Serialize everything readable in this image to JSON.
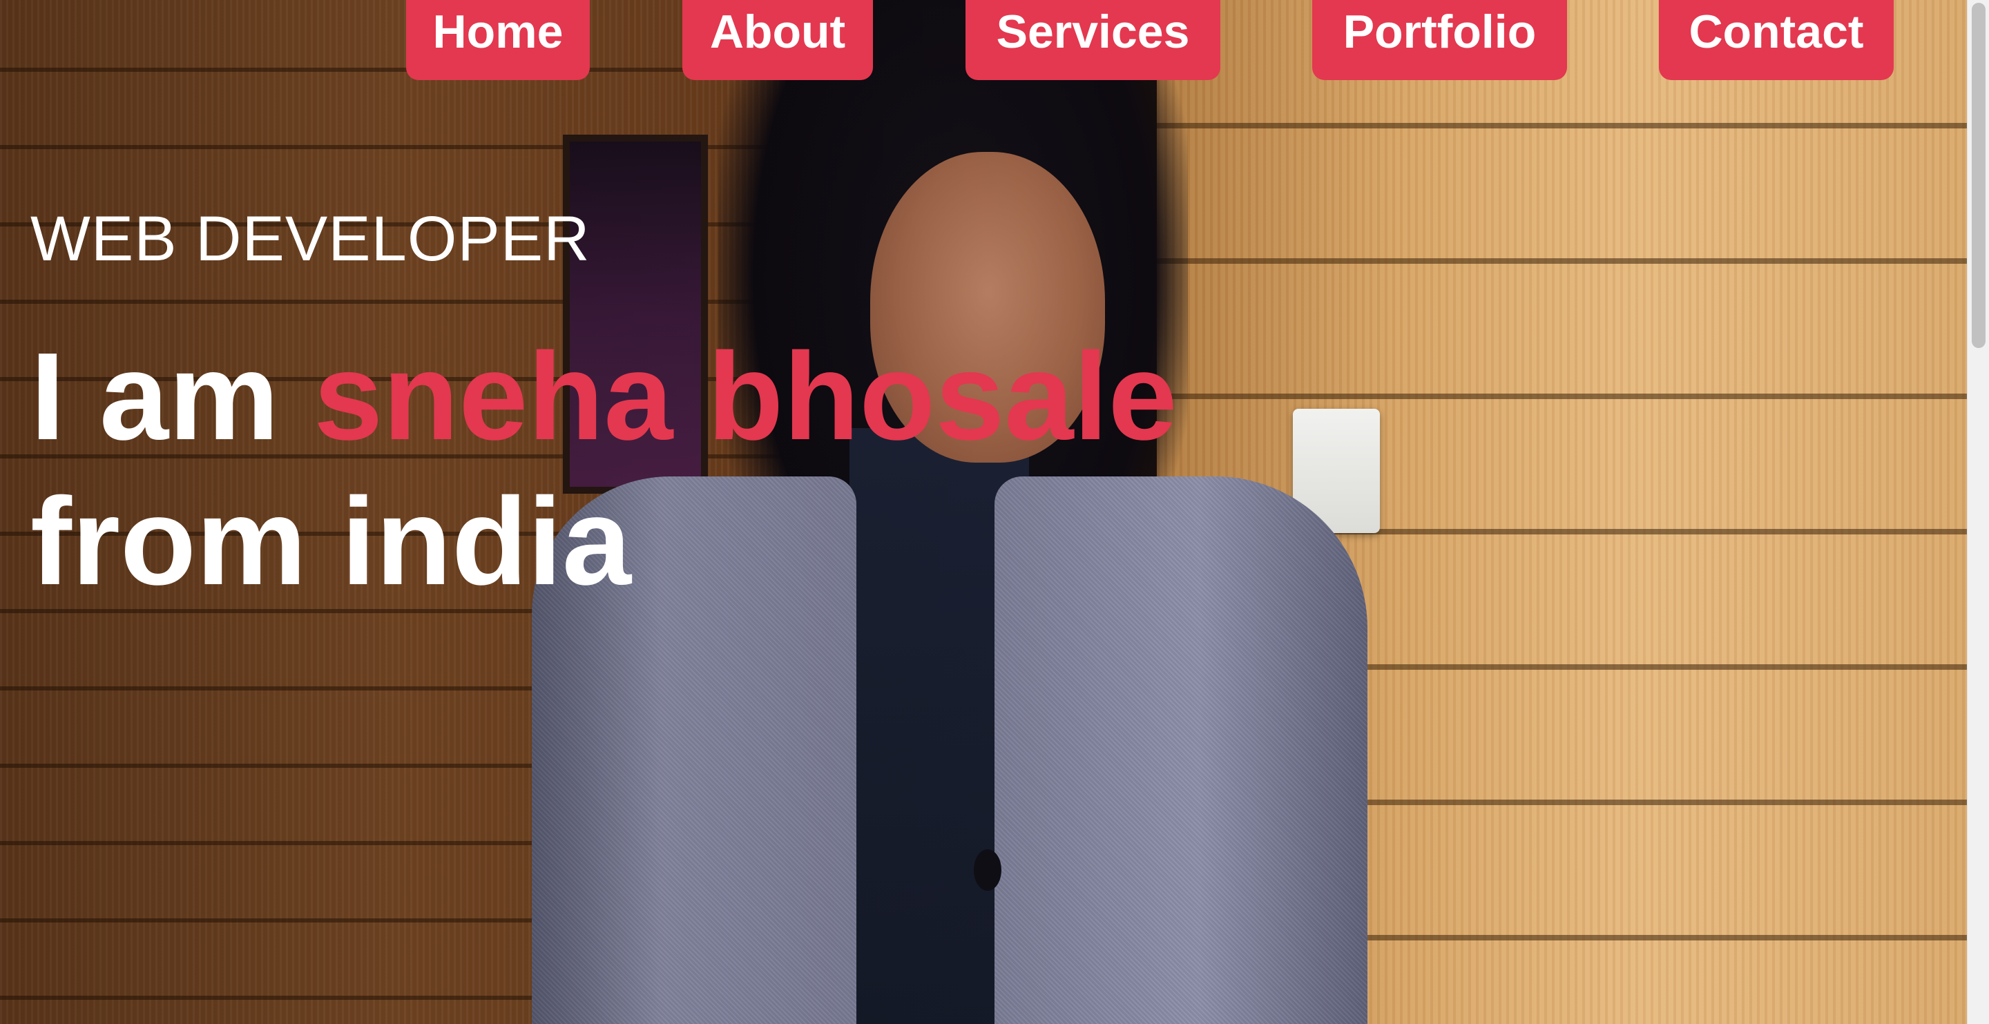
{
  "nav": {
    "items": [
      {
        "label": "Home"
      },
      {
        "label": "About"
      },
      {
        "label": "Services"
      },
      {
        "label": "Portfolio"
      },
      {
        "label": "Contact"
      }
    ]
  },
  "hero": {
    "role": "WEB DEVELOPER",
    "intro_prefix": "I am ",
    "name": "sneha bhosale",
    "intro_suffix": "from india"
  },
  "colors": {
    "accent": "#e3384f",
    "text": "#ffffff"
  }
}
